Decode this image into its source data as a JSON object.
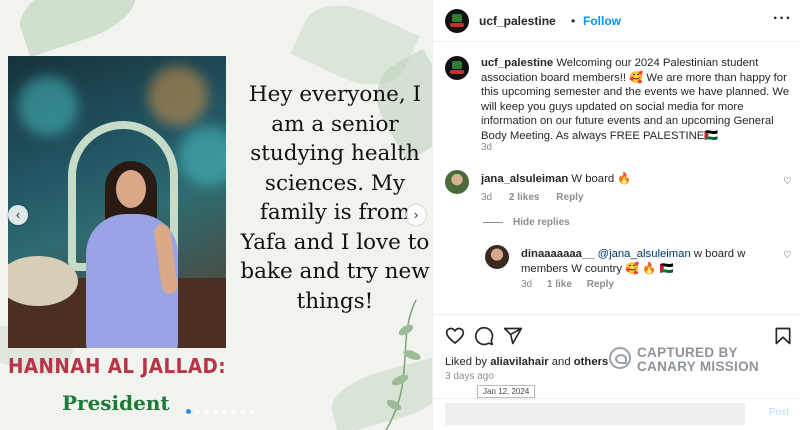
{
  "post": {
    "caption_lines": [
      "Hey everyone, I",
      "am a senior",
      "studying health",
      "sciences. My",
      "family is from",
      "Yafa and I love to",
      "bake and try new",
      "things!"
    ],
    "name": "HANNAH AL JALLAD:",
    "role": "President",
    "carousel_prev": "‹",
    "carousel_next": "›",
    "slide_count": 8,
    "active_slide": 1
  },
  "header": {
    "username": "ucf_palestine",
    "separator": "•",
    "follow_label": "Follow",
    "more_label": "···"
  },
  "caption": {
    "username": "ucf_palestine",
    "text": " Welcoming our 2024 Palestinian student association board members!! 🥰 We are more than happy for this upcoming semester and the events we have planned. We will keep you guys updated on social media for more information on our future events and an upcoming General Body Meeting. As always FREE PALESTINE🇵🇸",
    "age": "3d"
  },
  "comments": [
    {
      "username": "jana_alsuleiman",
      "text": " W board 🔥",
      "age": "3d",
      "likes": "2 likes",
      "reply": "Reply"
    }
  ],
  "hide_replies": "Hide replies",
  "reply": {
    "username": "dinaaaaaaa__",
    "mention": " @jana_alsuleiman",
    "text": " w board w members W country 🥰 🔥 🇵🇸",
    "age": "3d",
    "likes": "1 like",
    "reply": "Reply"
  },
  "likes": {
    "prefix": "Liked by ",
    "user": "aliavilahair",
    "and": " and ",
    "others": "others"
  },
  "post_age": "3 days ago",
  "tooltip": "Jan 12, 2024",
  "watermark": {
    "line1": "CAPTURED BY",
    "line2": "CANARY MISSION"
  },
  "comment_box": {
    "placeholder": "",
    "post_label": "Post"
  },
  "colors": {
    "follow": "#0095f6",
    "name": "#b83449",
    "role": "#1f7a3a"
  }
}
